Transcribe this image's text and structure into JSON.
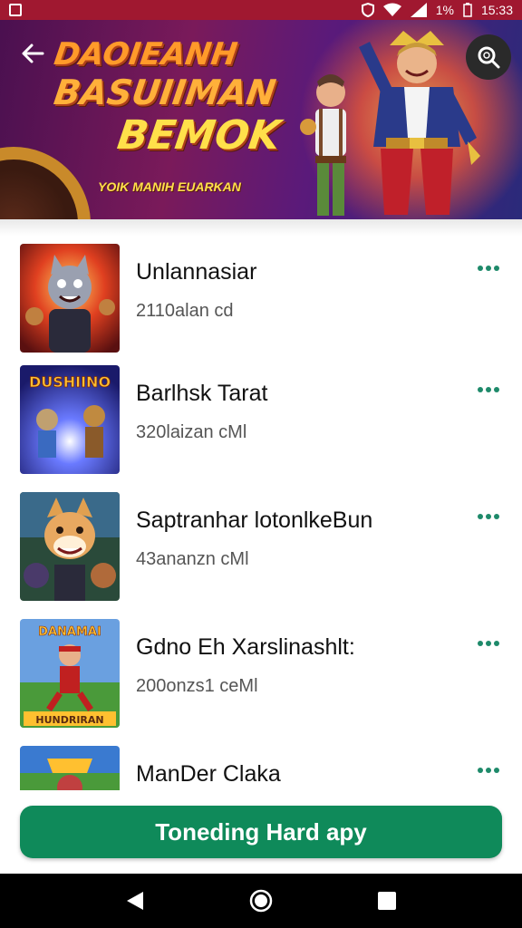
{
  "status": {
    "battery": "1%",
    "time": "15:33"
  },
  "banner": {
    "title_line1": "DAOIEANH",
    "title_line2": "BASUIIMAN",
    "title_line3": "BEMOK",
    "tagline": "YOIK MANIH EUARKAN"
  },
  "items": [
    {
      "title": "Unlannasiar",
      "subtitle": "2110alan cd"
    },
    {
      "title": "Barlhsk Tarat",
      "subtitle": "320laizan cMl"
    },
    {
      "title": "Saptranhar lotonlkeBun",
      "subtitle": "43ananzn cMl"
    },
    {
      "title": "Gdno Eh Xarslinashlt:",
      "subtitle": "200onzs1 ceMl"
    },
    {
      "title": "ManDer Claka",
      "subtitle": ""
    }
  ],
  "thumbs": {
    "t2": "DUSHIINO",
    "t4_top": "DANAMAI",
    "t4_bottom": "HUNDRIRAN"
  },
  "cta": {
    "label": "Toneding Hard apy"
  }
}
